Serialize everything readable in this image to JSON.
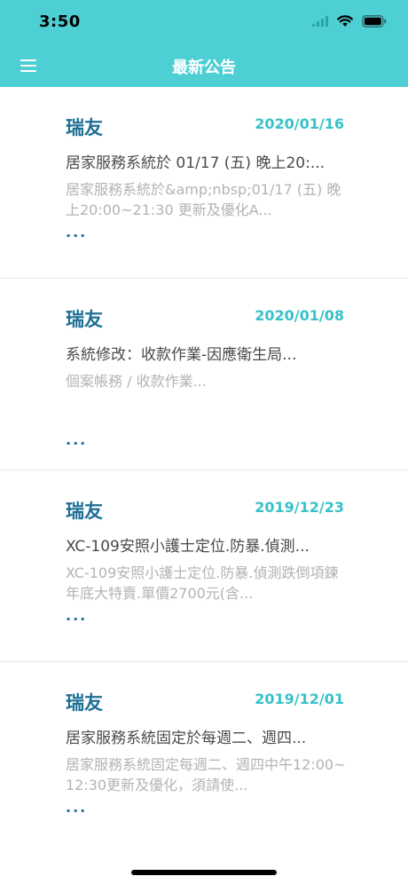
{
  "status_bar": {
    "time": "3:50"
  },
  "nav": {
    "title": "最新公告",
    "menu_icon": "hamburger-menu-icon"
  },
  "announcements": [
    {
      "author": "瑞友",
      "date": "2020/01/16",
      "title": "居家服務系統於 01/17 (五) 晚上20:...",
      "summary": "居家服務系統於&amp;nbsp;01/17 (五) 晚上20:00~21:30 更新及優化A...",
      "more": "..."
    },
    {
      "author": "瑞友",
      "date": "2020/01/08",
      "title": "系統修改：收款作業-因應衛生局...",
      "summary": "個案帳務 / 收款作業...",
      "more": "..."
    },
    {
      "author": "瑞友",
      "date": "2019/12/23",
      "title": "XC-109安照小護士定位.防暴.偵測...",
      "summary": "XC-109安照小護士定位.防暴.偵測跌倒項鍊年底大特賣.單價2700元(含...",
      "more": "..."
    },
    {
      "author": "瑞友",
      "date": "2019/12/01",
      "title": "居家服務系統固定於每週二、週四...",
      "summary": "居家服務系統固定每週二、週四中午12:00~12:30更新及優化，須請使...",
      "more": "..."
    }
  ]
}
